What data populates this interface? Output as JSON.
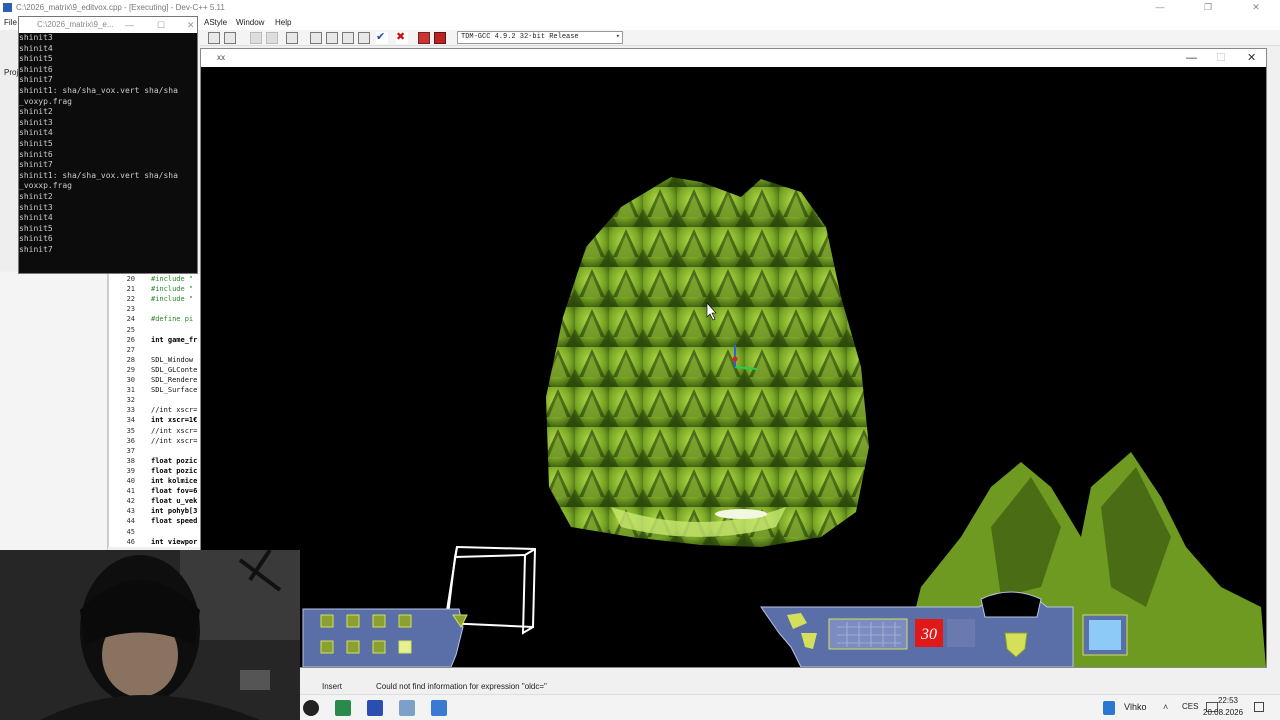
{
  "devcpp": {
    "title": "C:\\2026_matrix\\9_editvox.cpp - [Executing] - Dev-C++ 5.11",
    "menu": {
      "file": "File",
      "astyle": "AStyle",
      "window": "Window",
      "help": "Help"
    },
    "compiler": "TDM-GCC 4.9.2 32-bit Release",
    "project_tab": "Proj",
    "window_controls": {
      "minimize": "—",
      "maximize": "❐",
      "close": "✕"
    }
  },
  "console": {
    "title": "C:\\2026_matrix\\9_e...",
    "lines": [
      "shinit3",
      "shinit4",
      "shinit5",
      "shinit6",
      "shinit7",
      "shinit1: sha/sha_vox.vert sha/sha",
      "_voxyp.frag",
      "shinit2",
      "shinit3",
      "shinit4",
      "shinit5",
      "shinit6",
      "shinit7",
      "shinit1: sha/sha_vox.vert sha/sha",
      "_voxxp.frag",
      "shinit2",
      "shinit3",
      "shinit4",
      "shinit5",
      "shinit6",
      "shinit7"
    ]
  },
  "editor": {
    "lines": [
      {
        "n": "20",
        "code": "#include \"",
        "style": "green"
      },
      {
        "n": "21",
        "code": "#include \"",
        "style": "green"
      },
      {
        "n": "22",
        "code": "#include \"",
        "style": "green"
      },
      {
        "n": "23",
        "code": "",
        "style": ""
      },
      {
        "n": "24",
        "code": "#define pi",
        "style": "green"
      },
      {
        "n": "25",
        "code": "",
        "style": ""
      },
      {
        "n": "26",
        "code": "int game_fr",
        "style": "kw"
      },
      {
        "n": "27",
        "code": "",
        "style": ""
      },
      {
        "n": "28",
        "code": "SDL_Window",
        "style": ""
      },
      {
        "n": "29",
        "code": "SDL_GLConte",
        "style": ""
      },
      {
        "n": "30",
        "code": "SDL_Rendere",
        "style": ""
      },
      {
        "n": "31",
        "code": "SDL_Surface",
        "style": ""
      },
      {
        "n": "32",
        "code": "",
        "style": ""
      },
      {
        "n": "33",
        "code": "//int xscr=",
        "style": ""
      },
      {
        "n": "34",
        "code": "int xscr=1€",
        "style": "kw"
      },
      {
        "n": "35",
        "code": "//int xscr=",
        "style": ""
      },
      {
        "n": "36",
        "code": "//int xscr=",
        "style": ""
      },
      {
        "n": "37",
        "code": "",
        "style": ""
      },
      {
        "n": "38",
        "code": "float pozic",
        "style": "kw"
      },
      {
        "n": "39",
        "code": "float pozic",
        "style": "kw"
      },
      {
        "n": "40",
        "code": "int kolmice",
        "style": "kw"
      },
      {
        "n": "41",
        "code": "float fov=6",
        "style": "kw"
      },
      {
        "n": "42",
        "code": "float u_vek",
        "style": "kw"
      },
      {
        "n": "43",
        "code": "int pohyb[3",
        "style": "kw"
      },
      {
        "n": "44",
        "code": "float speed",
        "style": "kw"
      },
      {
        "n": "45",
        "code": "",
        "style": ""
      },
      {
        "n": "46",
        "code": "int viewpor",
        "style": "kw"
      }
    ]
  },
  "game": {
    "title": "xx",
    "window_controls": {
      "minimize": "—",
      "maximize": "☐",
      "close": "✕"
    },
    "hud": {
      "counter": "30"
    }
  },
  "status": {
    "mode": "Insert",
    "message": "Could not find information for expression \"oldc=\""
  },
  "taskbar": {
    "weather": "Vlhko",
    "language": "CES",
    "time": "22:53",
    "date": "20.08.2026"
  },
  "colors": {
    "voxel_light": "#a8d040",
    "voxel_dark": "#2d4a0a",
    "hud_blue": "#5a6fa8",
    "hud_counter": "#e01818"
  }
}
